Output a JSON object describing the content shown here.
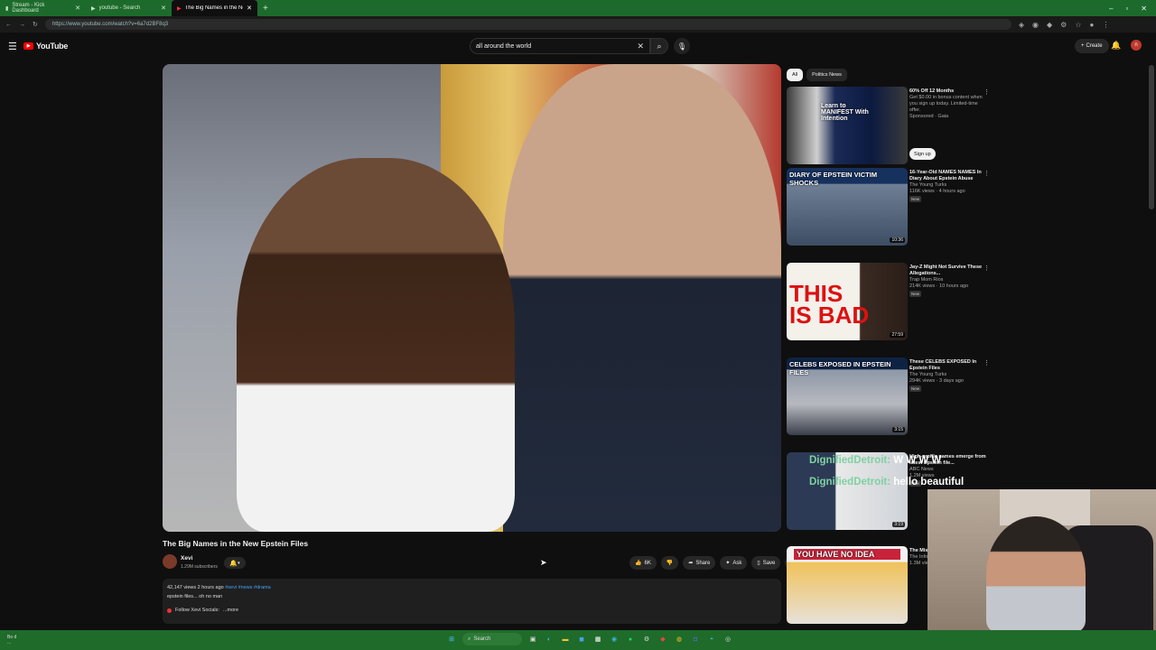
{
  "browser": {
    "tabs": [
      {
        "label": "Stream - Kick Dashboard"
      },
      {
        "label": "youtube - Search"
      },
      {
        "label": "The Big Names in the New Epstein Files"
      }
    ],
    "url": "https://www.youtube.com/watch?v=6a7d2BF8q3"
  },
  "header": {
    "logo_text": "YouTube",
    "search_value": "all around the world",
    "create_label": "Create",
    "avatar_letter": "n"
  },
  "video": {
    "title": "The Big Names in the New Epstein Files",
    "channel_name": "Xevi",
    "channel_subs": "1.29M subscribers",
    "likes": "6K",
    "share_label": "Share",
    "ask_label": "Ask",
    "save_label": "Save",
    "views_line": "42,147 views  2 hours ago",
    "hashtags": "#xevi #news #drama",
    "desc_line": "epstein files... oh no man",
    "follow_line": "Follow Xevi Socials:",
    "more_label": "...more"
  },
  "chips": [
    {
      "label": "All"
    },
    {
      "label": "Politics News"
    }
  ],
  "sidebar": {
    "items": [
      {
        "title": "60% Off 12 Months",
        "channel": "Get $0.00 in bonus content when you sign up today. Limited-time offer.",
        "meta": "Sponsored · Gaia",
        "badge": "",
        "caption": "Learn to MANIFEST With Intention",
        "duration": "",
        "signup": "Sign up"
      },
      {
        "title": "16-Year-Old NAMES NAMES In Diary About Epstein Abuse",
        "channel": "The Young Turks",
        "meta": "116K views · 4 hours ago",
        "badge": "New",
        "caption": "DIARY OF EPSTEIN VICTIM SHOCKS",
        "duration": "10:36"
      },
      {
        "title": "Jay-Z Might Not Survive These Allegations...",
        "channel": "Trap Mom Rios",
        "meta": "214K views · 10 hours ago",
        "badge": "New",
        "caption": "THIS IS BAD",
        "duration": "27:59"
      },
      {
        "title": "These CELEBS EXPOSED In Epstein Files",
        "channel": "The Young Turks",
        "meta": "294K views · 3 days ago",
        "badge": "New",
        "caption": "CELEBS EXPOSED IN EPSTEIN FILES",
        "duration": "3:15"
      },
      {
        "title": "High-profile names emerge from latest Epstein file...",
        "channel": "ABC News",
        "meta": "1.2M views",
        "badge": "New",
        "caption": "",
        "duration": "3:19"
      },
      {
        "title": "The Mis... Jeffrey...",
        "channel": "The Infog...",
        "meta": "1.3M views",
        "badge": "",
        "caption": "YOU HAVE NO IDEA",
        "duration": ""
      }
    ]
  },
  "chat": [
    {
      "user": "DignifiedDetroit:",
      "msg": "W W W W"
    },
    {
      "user": "DignifiedDetroit:",
      "msg": "hello beautiful"
    }
  ],
  "taskbar": {
    "weather_line1": "Bo d",
    "weather_line2": "...",
    "search_label": "Search"
  },
  "colors": {
    "accent": "#ff0000",
    "chrome_green": "#1d6b2c",
    "chat_user": "#7fd1a1"
  }
}
